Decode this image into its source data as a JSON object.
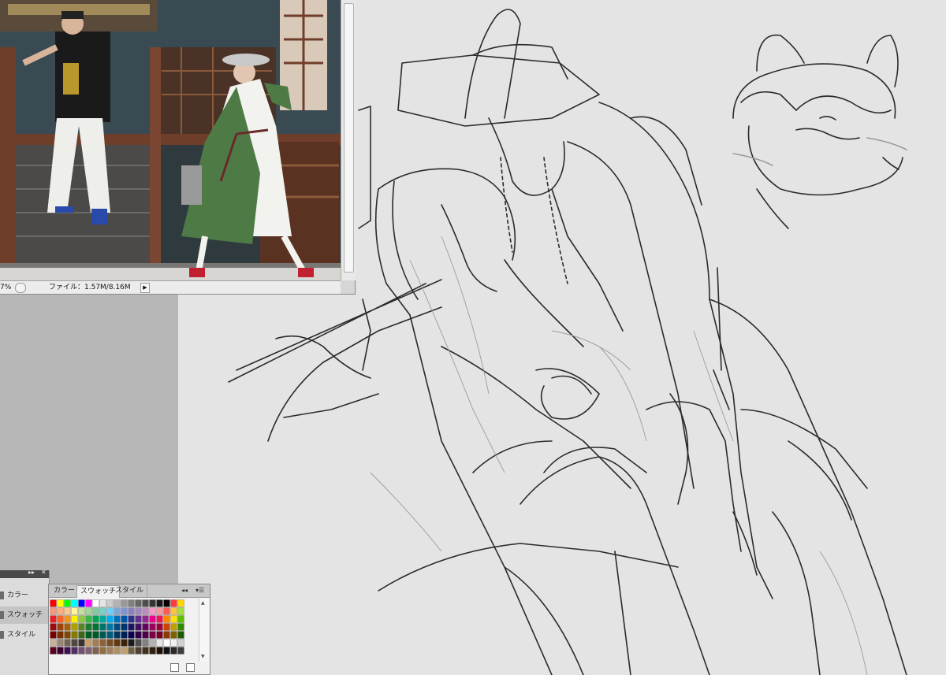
{
  "reference_window": {
    "zoom_text": "7%",
    "file_info": "ファイル：1.57M/8.16M",
    "arrow_label": "▶"
  },
  "side_panel": {
    "header_arrows": "▸▸",
    "header_close": "✕",
    "items": [
      {
        "label": "カラー"
      },
      {
        "label": "スウォッチ"
      },
      {
        "label": "スタイル"
      }
    ]
  },
  "swatches_panel": {
    "tabs": [
      "カラー",
      "スウォッチ",
      "スタイル"
    ],
    "collapse_label": "◂◂",
    "menu_label": "▾☰",
    "scroll_up": "▲",
    "scroll_down": "▼",
    "colors": {
      "top_row": [
        "#ff0000",
        "#ffff00",
        "#00ff00",
        "#00ffff",
        "#0000ff",
        "#ff00ff",
        "#ffffff",
        "#e6e6e6",
        "#cccccc",
        "#b3b3b3",
        "#999999",
        "#808080",
        "#666666",
        "#4d4d4d",
        "#333333",
        "#1a1a1a",
        "#000000",
        "#ff3b3b",
        "#ffd700"
      ],
      "palette_rows": [
        [
          "#f7977a",
          "#f9ad81",
          "#fdc68a",
          "#fff79a",
          "#c4df9b",
          "#a2d39c",
          "#82ca9d",
          "#7bcdc8",
          "#6ecff6",
          "#7ea7d8",
          "#8493ca",
          "#8882be",
          "#a187be",
          "#bc8dbf",
          "#f49ac2",
          "#f6989d",
          "#ff5a5a",
          "#ffc53d",
          "#a0e040"
        ],
        [
          "#ed1c24",
          "#f26522",
          "#f7941d",
          "#fff200",
          "#8dc73f",
          "#39b54a",
          "#00a651",
          "#00a99d",
          "#00aeef",
          "#0072bc",
          "#0054a6",
          "#2e3192",
          "#662d91",
          "#92278f",
          "#ec008c",
          "#ed145b",
          "#ff8a00",
          "#ffe000",
          "#60c000"
        ],
        [
          "#9e0b0f",
          "#a0410d",
          "#a36209",
          "#aba000",
          "#598527",
          "#1a7b30",
          "#007236",
          "#00746b",
          "#0076a3",
          "#004b80",
          "#003471",
          "#1b1464",
          "#440e62",
          "#630460",
          "#9e005d",
          "#9e0039",
          "#d04000",
          "#c0a000",
          "#2f8a00"
        ],
        [
          "#790000",
          "#7b2e00",
          "#7d4900",
          "#827b00",
          "#406618",
          "#005e20",
          "#005826",
          "#005952",
          "#005b7f",
          "#003663",
          "#002157",
          "#0d004c",
          "#32004b",
          "#4b0049",
          "#7b0046",
          "#7a0026",
          "#8c3a00",
          "#806000",
          "#1e5a00"
        ],
        [
          "#c7b299",
          "#998675",
          "#736357",
          "#534741",
          "#37302d",
          "#c69c6d",
          "#a67c52",
          "#8c6239",
          "#754c24",
          "#603913",
          "#3b2209",
          "#1a1a1a",
          "#4d4d4d",
          "#808080",
          "#b3b3b3",
          "#e6e6e6",
          "#ffffff",
          "#f0f0f0",
          "#d0d0d0"
        ],
        [
          "#5a0020",
          "#3a0030",
          "#401050",
          "#503060",
          "#705070",
          "#806070",
          "#806050",
          "#907040",
          "#a08060",
          "#b09060",
          "#c0a070",
          "#706040",
          "#504030",
          "#403020",
          "#302010",
          "#201008",
          "#101010",
          "#2a2a2a",
          "#3a3a3a"
        ]
      ]
    }
  },
  "photo_colors": {
    "sky": "#3a4a52",
    "wood": "#6e3e2a",
    "stage": "#4b4a48",
    "robe_white": "#f2f2ee",
    "robe_green": "#4e7a46"
  },
  "sketch": {
    "stroke": "#2b2b2b"
  }
}
